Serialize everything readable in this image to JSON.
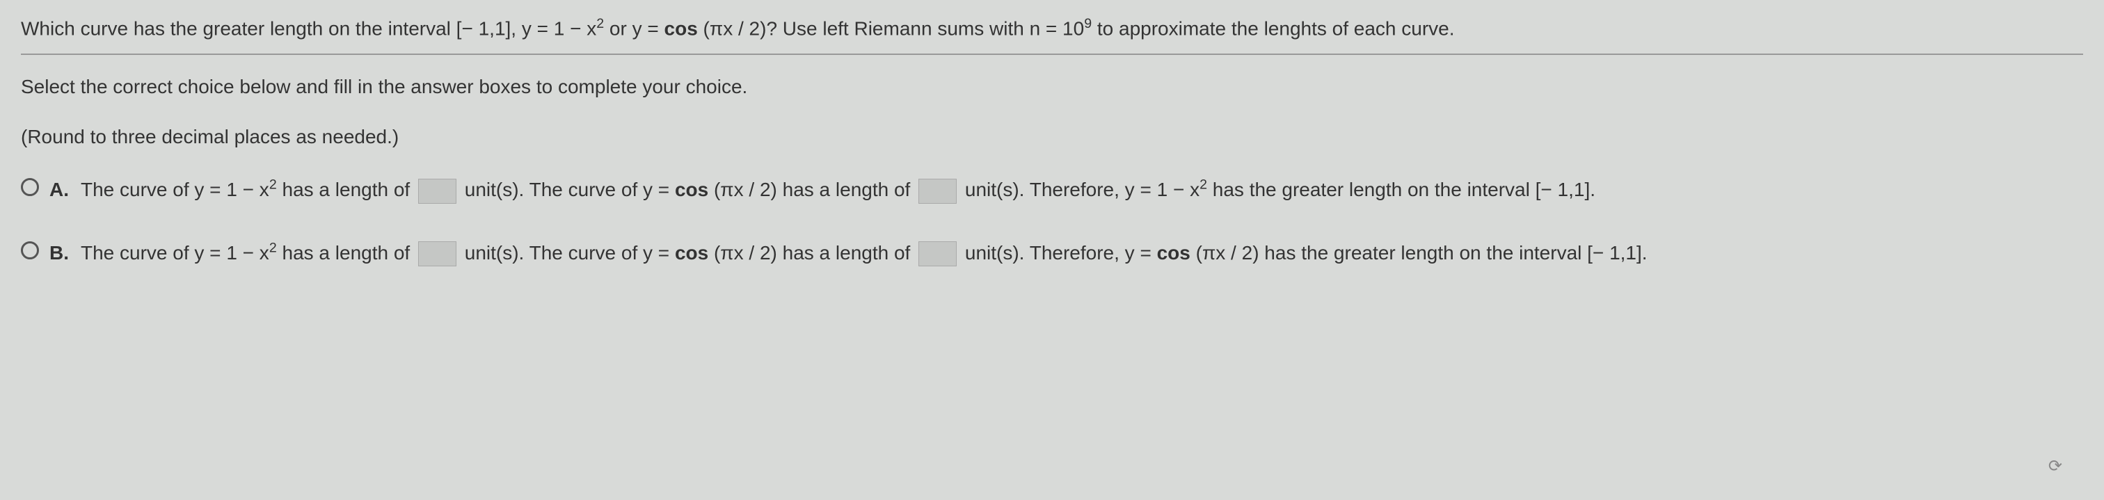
{
  "question": {
    "prefix": "Which curve has the greater length on the interval [− 1,1], y = 1 − x",
    "exp1": "2",
    "mid1": " or y = ",
    "bold1": "cos",
    "mid2": " (πx / 2)?  Use left Riemann sums with n = 10",
    "exp2": "9",
    "suffix": " to approximate the lenghts of each curve."
  },
  "instruction": "Select the correct choice below and fill in the answer boxes to complete your choice.",
  "hint": "(Round to three decimal places as needed.)",
  "choices": {
    "a": {
      "label": "A.",
      "p1": "The curve of y = 1 − x",
      "e1": "2",
      "p2": " has a length of ",
      "p3": " unit(s). The curve of y = ",
      "b1": "cos",
      "p4": " (πx / 2) has a length of ",
      "p5": " unit(s). Therefore, y = 1 − x",
      "e2": "2",
      "p6": " has the greater length on the interval [− 1,1]."
    },
    "b": {
      "label": "B.",
      "p1": "The curve of y = 1 − x",
      "e1": "2",
      "p2": " has a length of ",
      "p3": " unit(s). The curve of y = ",
      "b1": "cos",
      "p4": " (πx / 2) has a length of ",
      "p5": " unit(s). Therefore, y = ",
      "b2": "cos",
      "p6": " (πx / 2) has the greater length on the interval [− 1,1]."
    }
  }
}
